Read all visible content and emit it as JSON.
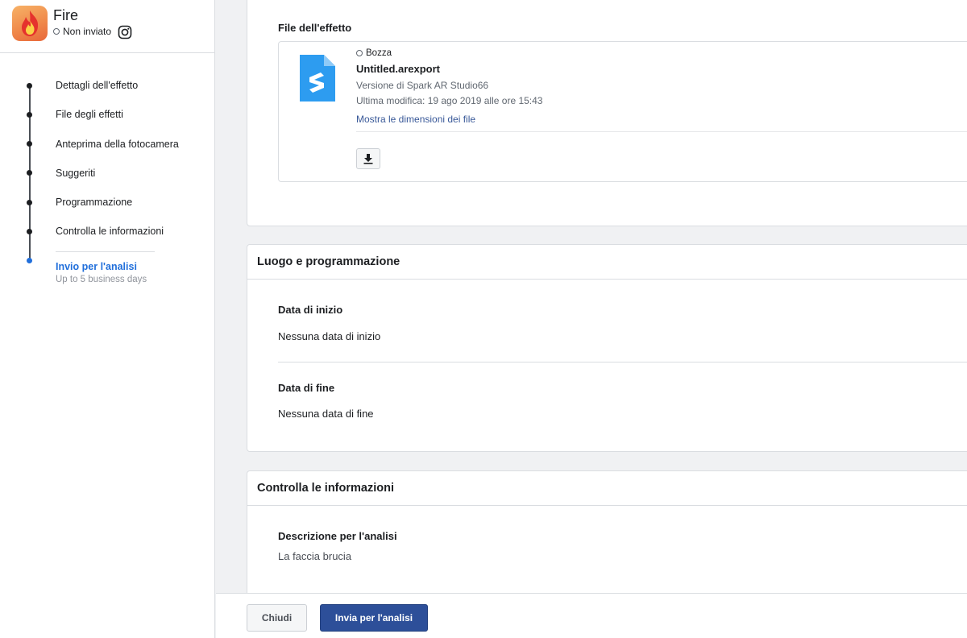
{
  "project": {
    "name": "Fire",
    "status": "Non inviato"
  },
  "sidebar": {
    "steps": [
      {
        "label": "Dettagli dell'effetto"
      },
      {
        "label": "File degli effetti"
      },
      {
        "label": "Anteprima della fotocamera"
      },
      {
        "label": "Suggeriti"
      },
      {
        "label": "Programmazione"
      },
      {
        "label": "Controlla le informazioni"
      }
    ],
    "active_step": {
      "label": "Invio per l'analisi",
      "sub": "Up to 5 business days"
    }
  },
  "file_section": {
    "title": "File dell'effetto",
    "status": "Bozza",
    "file_name": "Untitled.arexport",
    "version": "Versione di Spark AR Studio66",
    "modified": "Ultima modifica: 19 ago 2019 alle ore 15:43",
    "show_sizes_link": "Mostra le dimensioni dei file"
  },
  "schedule_card": {
    "title": "Luogo e programmazione",
    "start_label": "Data di inizio",
    "start_value": "Nessuna data di inizio",
    "end_label": "Data di fine",
    "end_value": "Nessuna data di fine"
  },
  "review_card": {
    "title": "Controlla le informazioni",
    "desc_label": "Descrizione per l'analisi",
    "desc_value": "La faccia brucia"
  },
  "footer": {
    "close_label": "Chiudi",
    "submit_label": "Invia per l'analisi"
  },
  "colors": {
    "accent": "#216fdb",
    "submit_bg": "#2d4f99",
    "file_icon": "#2d9cf0"
  }
}
